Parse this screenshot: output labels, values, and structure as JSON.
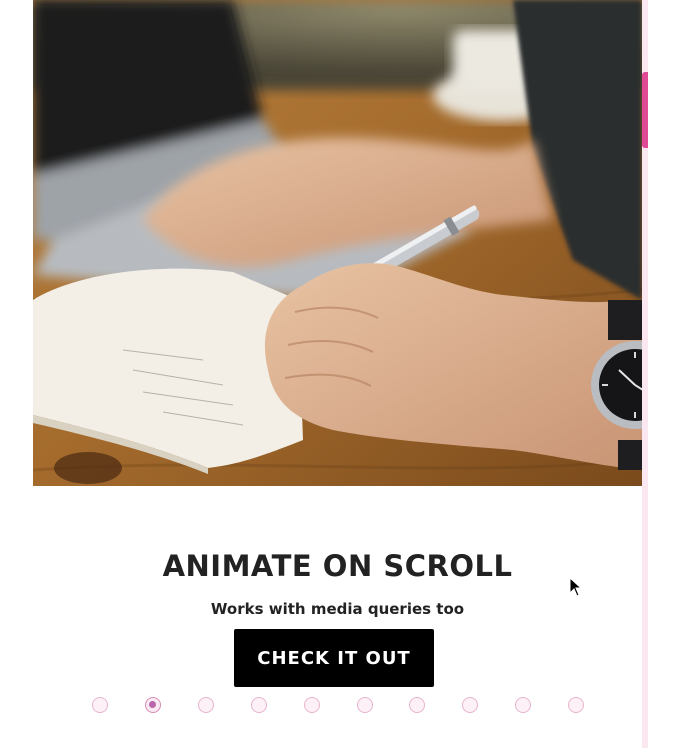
{
  "slide": {
    "image_alt": "Hands writing in a notebook with a pen next to a laptop",
    "title": "ANIMATE ON SCROLL",
    "subtitle": "Works with media queries too",
    "cta_label": "CHECK IT OUT"
  },
  "pagination": {
    "count": 10,
    "active_index": 1
  },
  "colors": {
    "accent": "#e04a94",
    "dot_active": "#b967a8",
    "button_bg": "#000000"
  }
}
